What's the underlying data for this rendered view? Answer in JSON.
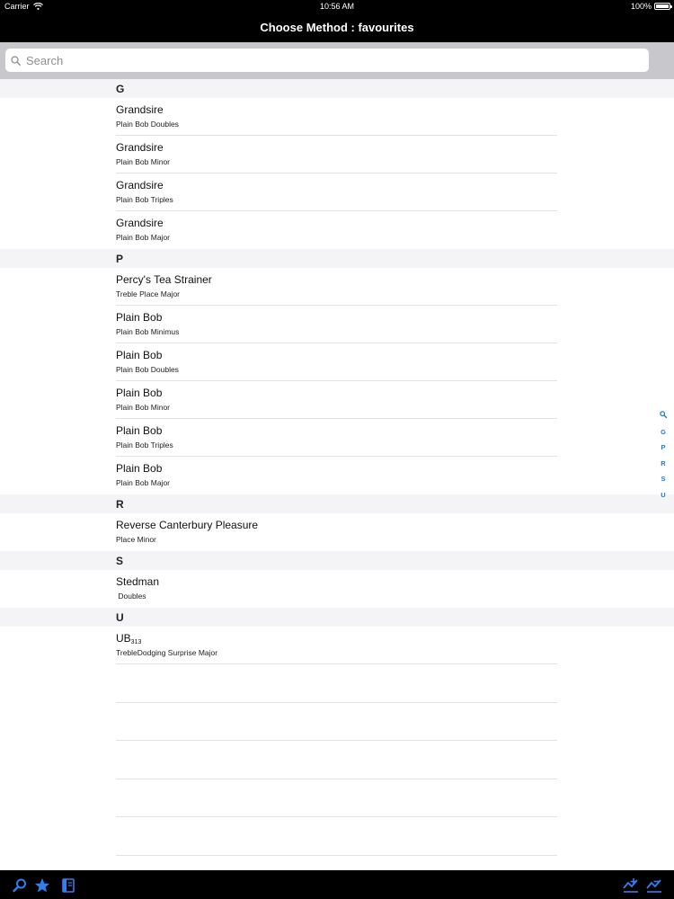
{
  "status": {
    "carrier": "Carrier",
    "time": "10:56 AM",
    "battery": "100%",
    "battery_level": 1.0
  },
  "nav": {
    "title": "Choose Method : favourites"
  },
  "search": {
    "placeholder": "Search",
    "value": ""
  },
  "sections": [
    {
      "letter": "G",
      "rows": [
        {
          "title": "Grandsire",
          "subtitle": "Plain Bob Doubles"
        },
        {
          "title": "Grandsire",
          "subtitle": "Plain Bob Minor"
        },
        {
          "title": "Grandsire",
          "subtitle": "Plain Bob Triples"
        },
        {
          "title": "Grandsire",
          "subtitle": "Plain Bob Major"
        }
      ]
    },
    {
      "letter": "P",
      "rows": [
        {
          "title": "Percy's Tea Strainer",
          "subtitle": "Treble Place Major"
        },
        {
          "title": "Plain Bob",
          "subtitle": "Plain Bob Minimus"
        },
        {
          "title": "Plain Bob",
          "subtitle": "Plain Bob Doubles"
        },
        {
          "title": "Plain Bob",
          "subtitle": "Plain Bob Minor"
        },
        {
          "title": "Plain Bob",
          "subtitle": "Plain Bob Triples"
        },
        {
          "title": "Plain Bob",
          "subtitle": "Plain Bob Major"
        }
      ]
    },
    {
      "letter": "R",
      "rows": [
        {
          "title": "Reverse Canterbury Pleasure",
          "subtitle": "Place Minor"
        }
      ]
    },
    {
      "letter": "S",
      "rows": [
        {
          "title": "Stedman",
          "subtitle": " Doubles"
        }
      ]
    },
    {
      "letter": "U",
      "rows": [
        {
          "title": "UB",
          "title_sub": "313",
          "subtitle": "TrebleDodging Surprise Major"
        }
      ]
    }
  ],
  "index": [
    "G",
    "P",
    "R",
    "S",
    "U"
  ],
  "icons": {
    "index_search": "magnifier-icon",
    "toolbar": [
      "search-icon",
      "star-icon",
      "book-icon",
      "method-edit-icon",
      "method-remove-icon"
    ]
  },
  "colors": {
    "accent": "#1e7bd6",
    "bar": "#000000",
    "search_bg": "#c8c8cc",
    "section_bg": "#f4f4f6"
  }
}
